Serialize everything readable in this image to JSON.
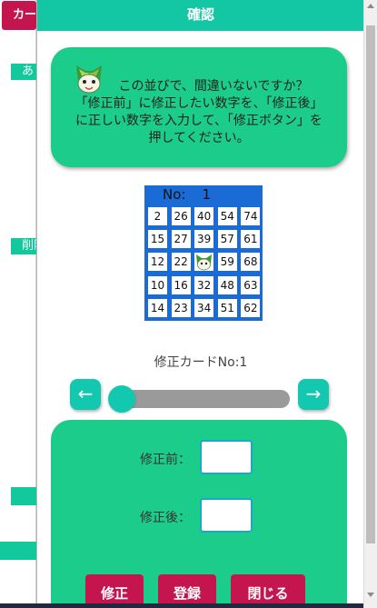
{
  "background": {
    "tab_label": "カード",
    "label1": "あ",
    "label2": "削除"
  },
  "modal": {
    "title": "確認",
    "message_lines": [
      "この並びで、間違いないですか？",
      "「修正前」に修正したい数字を、「修正後」",
      "に正しい数字を入力して、「修正ボタン」を",
      "押してください。"
    ]
  },
  "card": {
    "no_label": "No:",
    "no_value": "1",
    "rows": [
      [
        "2",
        "26",
        "40",
        "54",
        "74"
      ],
      [
        "15",
        "27",
        "39",
        "57",
        "61"
      ],
      [
        "12",
        "22",
        "FREE",
        "59",
        "68"
      ],
      [
        "10",
        "16",
        "32",
        "48",
        "63"
      ],
      [
        "14",
        "23",
        "34",
        "51",
        "62"
      ]
    ]
  },
  "fix_card_label": "修正カードNo:1",
  "slider": {
    "prev_label": "←",
    "next_label": "→",
    "value": 0
  },
  "form": {
    "before_label": "修正前：",
    "before_value": "",
    "after_label": "修正後：",
    "after_value": ""
  },
  "buttons": {
    "fix": "修正",
    "register": "登録",
    "close": "閉じる"
  },
  "colors": {
    "header": "#13c6a4",
    "panel": "#1ccc8b",
    "card_blue": "#1a6bd6",
    "button_red": "#c4154e"
  }
}
